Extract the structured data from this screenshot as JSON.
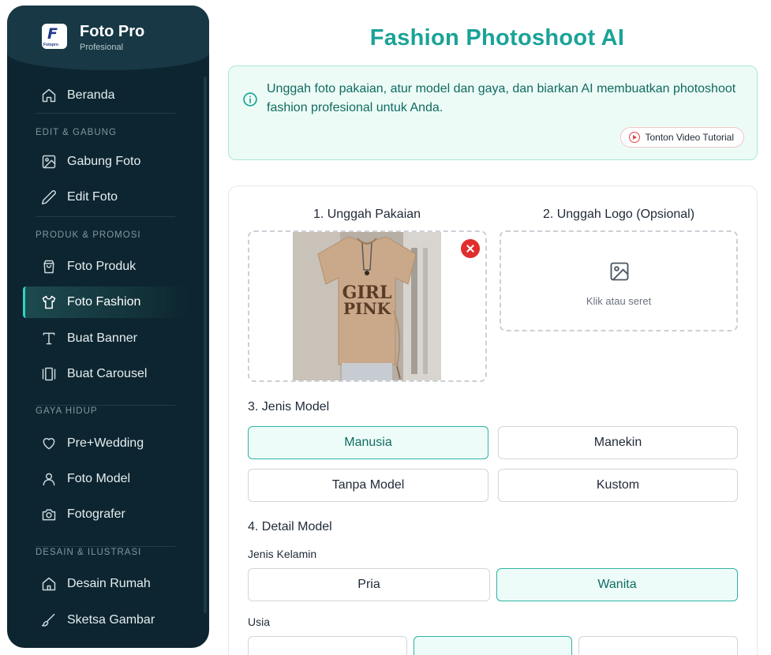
{
  "brand": {
    "title": "Foto Pro",
    "subtitle": "Profesional",
    "logo_letter": "F",
    "logo_text": "Fotopro"
  },
  "sidebar": {
    "items": [
      {
        "label": "Beranda",
        "icon": "home-icon"
      },
      {
        "section": "EDIT & GABUNG"
      },
      {
        "label": "Gabung Foto",
        "icon": "image-icon"
      },
      {
        "label": "Edit Foto",
        "icon": "pencil-icon"
      },
      {
        "section": "PRODUK & PROMOSI"
      },
      {
        "label": "Foto Produk",
        "icon": "shopping-bag-icon"
      },
      {
        "label": "Foto Fashion",
        "icon": "shirt-icon",
        "active": true
      },
      {
        "label": "Buat Banner",
        "icon": "type-icon"
      },
      {
        "label": "Buat Carousel",
        "icon": "carousel-icon"
      },
      {
        "section": "GAYA HIDUP"
      },
      {
        "label": "Pre+Wedding",
        "icon": "heart-icon"
      },
      {
        "label": "Foto Model",
        "icon": "user-icon"
      },
      {
        "label": "Fotografer",
        "icon": "camera-icon"
      },
      {
        "section": "DESAIN & ILUSTRASI"
      },
      {
        "label": "Desain Rumah",
        "icon": "house-icon"
      },
      {
        "label": "Sketsa Gambar",
        "icon": "brush-icon"
      }
    ]
  },
  "main": {
    "title": "Fashion Photoshoot AI",
    "info": "Unggah foto pakaian, atur model dan gaya, dan biarkan AI membuatkan photoshoot fashion profesional untuk Anda.",
    "tutorial_button": "Tonton Video Tutorial",
    "upload_garment_label": "1. Unggah Pakaian",
    "upload_logo_label": "2. Unggah Logo (Opsional)",
    "logo_hint": "Klik atau seret",
    "garment_print_line1": "GIRL",
    "garment_print_line2": "PINK",
    "model_type_heading": "3. Jenis Model",
    "model_types": [
      {
        "label": "Manusia",
        "selected": true
      },
      {
        "label": "Manekin",
        "selected": false
      },
      {
        "label": "Tanpa Model",
        "selected": false
      },
      {
        "label": "Kustom",
        "selected": false
      }
    ],
    "model_detail_heading": "4. Detail Model",
    "gender_label": "Jenis Kelamin",
    "genders": [
      {
        "label": "Pria",
        "selected": false
      },
      {
        "label": "Wanita",
        "selected": true
      }
    ],
    "age_label": "Usia"
  },
  "colors": {
    "accent": "#1aa397",
    "sidebar_bg": "#0d2530",
    "danger": "#e02d2d"
  }
}
